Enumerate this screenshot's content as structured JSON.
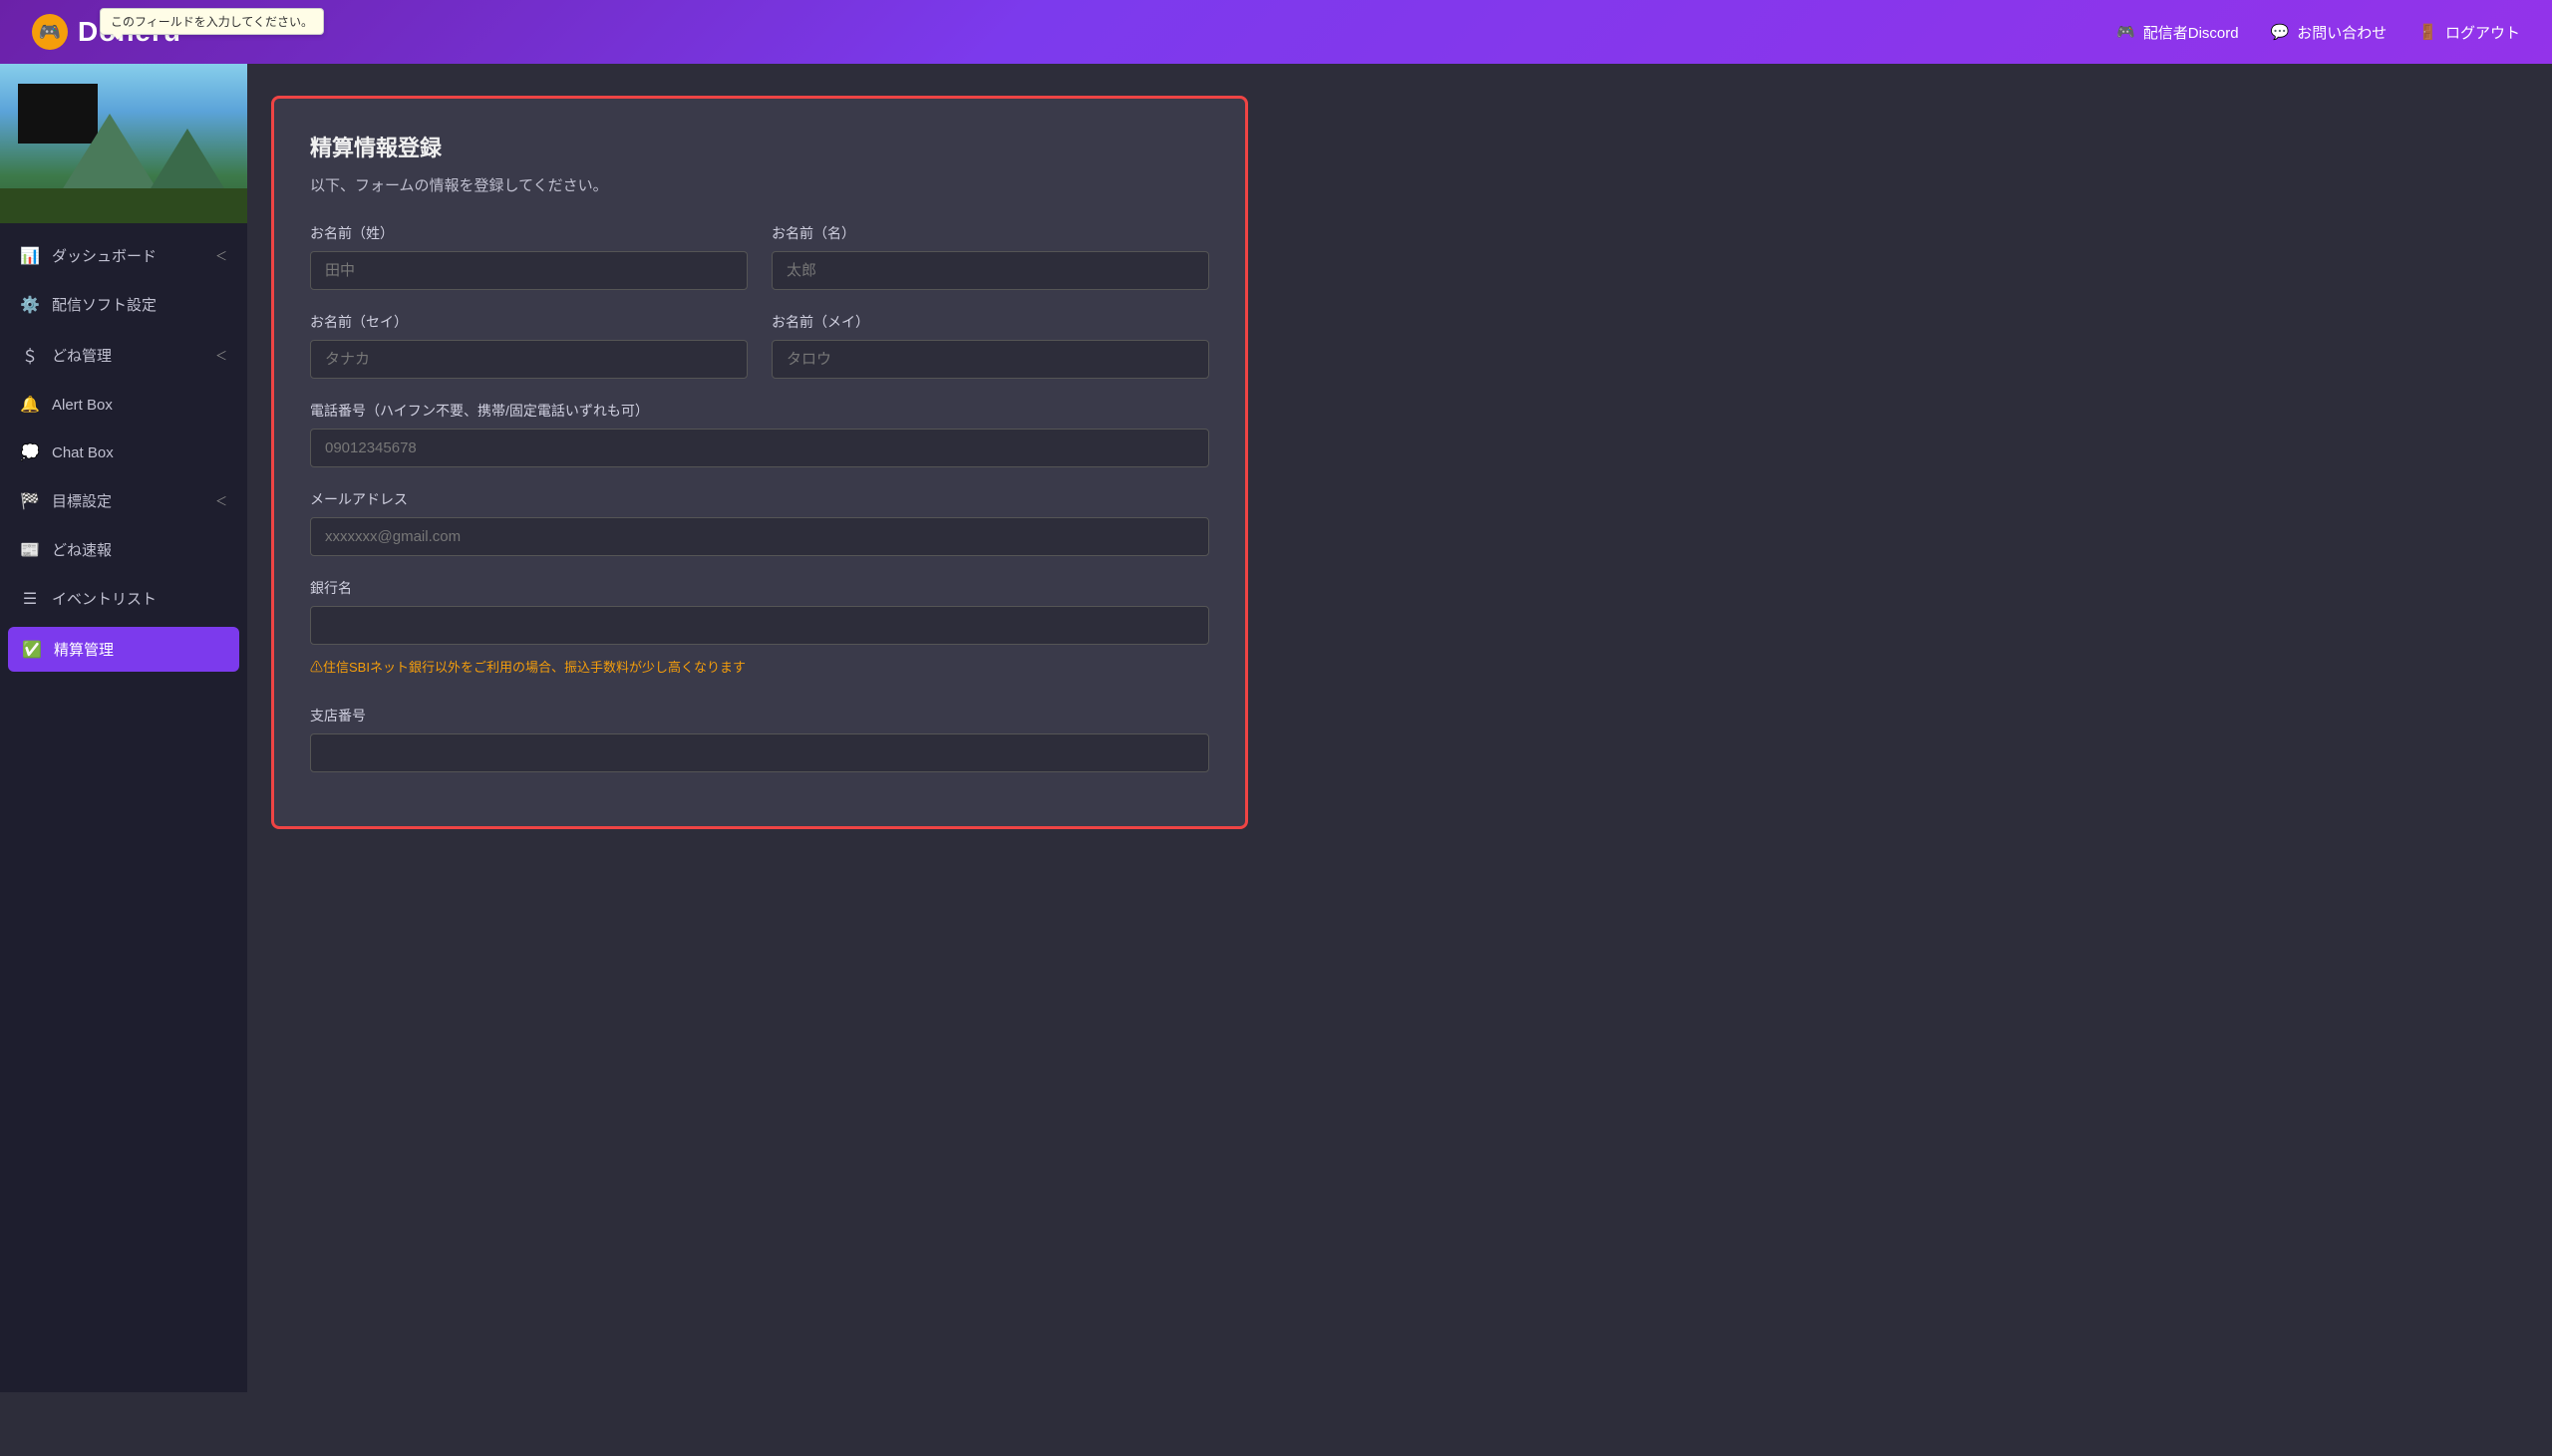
{
  "tooltip": {
    "text": "このフィールドを入力してください。"
  },
  "header": {
    "logo_text": "Doneru",
    "nav": [
      {
        "id": "discord",
        "icon": "🎮",
        "label": "配信者Discord"
      },
      {
        "id": "contact",
        "icon": "💬",
        "label": "お問い合わせ"
      },
      {
        "id": "logout",
        "icon": "🚪",
        "label": "ログアウト"
      }
    ]
  },
  "sidebar": {
    "items": [
      {
        "id": "dashboard",
        "icon": "📊",
        "label": "ダッシュボード",
        "hasChevron": true,
        "active": false
      },
      {
        "id": "stream-settings",
        "icon": "⚙️",
        "label": "配信ソフト設定",
        "hasChevron": false,
        "active": false
      },
      {
        "id": "done-management",
        "icon": "💲",
        "label": "どね管理",
        "hasChevron": true,
        "active": false
      },
      {
        "id": "alert-box",
        "icon": "🔔",
        "label": "Alert Box",
        "hasChevron": false,
        "active": false
      },
      {
        "id": "chat-box",
        "icon": "💭",
        "label": "Chat Box",
        "hasChevron": false,
        "active": false
      },
      {
        "id": "goal-settings",
        "icon": "🏁",
        "label": "目標設定",
        "hasChevron": true,
        "active": false
      },
      {
        "id": "done-news",
        "icon": "📰",
        "label": "どね速報",
        "hasChevron": false,
        "active": false
      },
      {
        "id": "event-list",
        "icon": "☰",
        "label": "イベントリスト",
        "hasChevron": false,
        "active": false
      },
      {
        "id": "payment-management",
        "icon": "✅",
        "label": "精算管理",
        "hasChevron": false,
        "active": true
      }
    ]
  },
  "form": {
    "title": "精算情報登録",
    "subtitle": "以下、フォームの情報を登録してください。",
    "fields": {
      "last_name_label": "お名前（姓）",
      "last_name_placeholder": "田中",
      "first_name_label": "お名前（名）",
      "first_name_placeholder": "太郎",
      "last_name_kana_label": "お名前（セイ）",
      "last_name_kana_placeholder": "タナカ",
      "first_name_kana_label": "お名前（メイ）",
      "first_name_kana_placeholder": "タロウ",
      "phone_label": "電話番号（ハイフン不要、携帯/固定電話いずれも可）",
      "phone_placeholder": "09012345678",
      "email_label": "メールアドレス",
      "email_placeholder": "xxxxxxx@gmail.com",
      "bank_name_label": "銀行名",
      "bank_name_placeholder": "",
      "bank_warning": "⚠住信SBIネット銀行以外をご利用の場合、振込手数料が少し高くなります",
      "branch_number_label": "支店番号",
      "branch_number_placeholder": ""
    }
  }
}
